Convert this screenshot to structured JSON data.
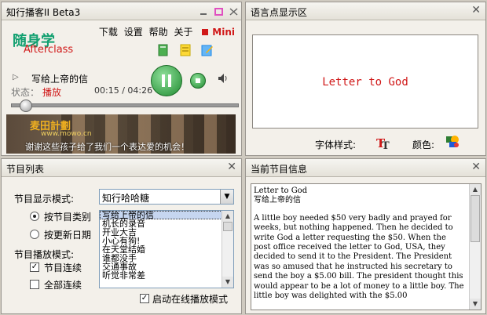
{
  "player": {
    "title": "知行播客II Beta3",
    "menu": [
      "下载",
      "设置",
      "帮助",
      "关于"
    ],
    "menu_logo": "Mini",
    "logo_cn": "随身学",
    "logo_en": "Afterclass",
    "now_playing": "写给上帝的信",
    "state_label": "状态：",
    "state_value": "播放",
    "time": "00:15 / 04:26",
    "banner_title": "麦田計劃",
    "banner_url": "www.mowo.cn",
    "banner_text": "谢谢这些孩子给了我们一个表达爱的机会！"
  },
  "language_panel": {
    "title": "语言点显示区",
    "display_text": "Letter to God",
    "font_label": "字体样式:",
    "color_label": "颜色:"
  },
  "playlist": {
    "title": "节目列表",
    "display_mode_label": "节目显示模式:",
    "display_mode_value": "知行哈哈糖",
    "sort_by_category": "按节目类别",
    "sort_by_date": "按更新日期",
    "play_mode_label": "节目播放模式:",
    "continuous": "节目连续",
    "all_continuous": "全部连续",
    "online_mode": "启动在线播放模式",
    "items": [
      "写给上帝的信",
      "机长的录音",
      "开业大吉",
      "小心有狗!",
      "在天堂结婚",
      "谁都没手",
      "交通事故",
      "听觉非常差"
    ]
  },
  "info_panel": {
    "title": "当前节目信息",
    "title_en": "Letter to God",
    "title_cn": "写给上帝的信",
    "body": "A little boy needed $50 very badly and prayed for weeks, but nothing happened. Then he decided to write God a letter requesting the $50. When the post office received the letter to God, USA, they decided to send it to the President. The President was so amused that he instructed his secretary to send the boy a $5.00 bill. The president thought this would appear to be a lot of money to a little boy. The little boy was delighted with the $5.00"
  },
  "colors": {
    "accent_red": "#d01818",
    "brand_green": "#12a070"
  }
}
